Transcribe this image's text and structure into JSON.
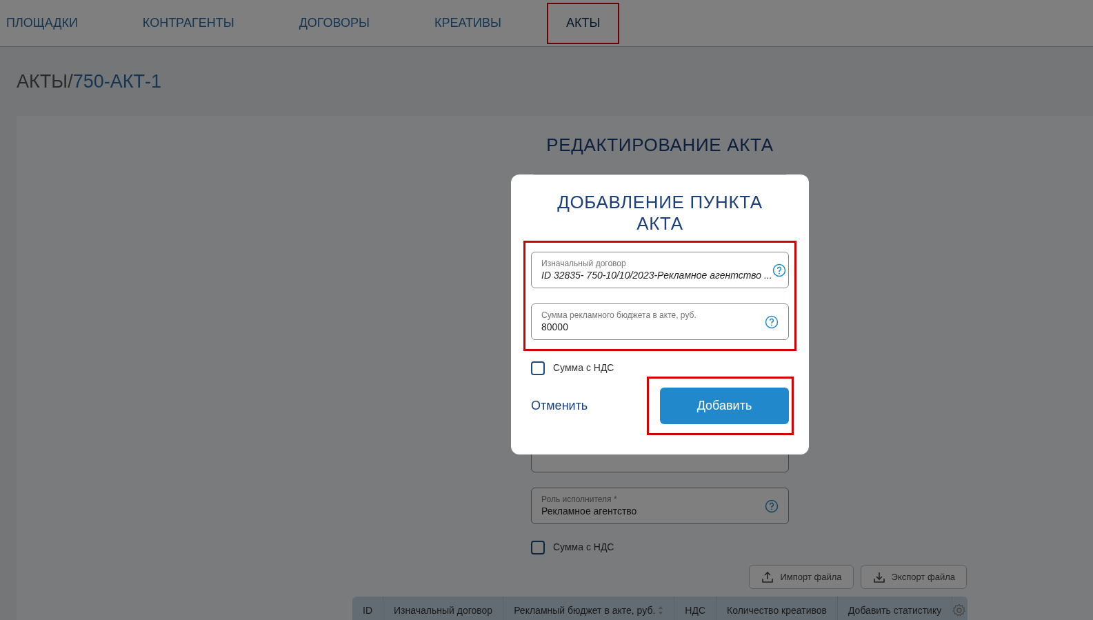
{
  "nav": {
    "tabs": [
      {
        "label": "ПЛОЩАДКИ",
        "selected": false,
        "highlighted": false
      },
      {
        "label": "КОНТРАГЕНТЫ",
        "selected": false,
        "highlighted": false
      },
      {
        "label": "ДОГОВОРЫ",
        "selected": false,
        "highlighted": false
      },
      {
        "label": "КРЕАТИВЫ",
        "selected": false,
        "highlighted": false
      },
      {
        "label": "АКТЫ",
        "selected": true,
        "highlighted": true
      }
    ]
  },
  "breadcrumb": {
    "section": "АКТЫ/",
    "current": "750-АКТ-1"
  },
  "form": {
    "title": "РЕДАКТИРОВАНИЕ АКТА",
    "fields": [
      {
        "label": "Роль исполнителя *",
        "value": "Рекламное агентство"
      }
    ],
    "checkbox": {
      "label": "Сумма с НДС",
      "checked": false
    }
  },
  "toolbar": [
    {
      "label": "Импорт файла",
      "kind": "upload"
    },
    {
      "label": "Экспорт файла",
      "kind": "download"
    }
  ],
  "table": {
    "columns": [
      {
        "label": "ID",
        "sortable": false
      },
      {
        "label": "Изначальный договор",
        "sortable": false
      },
      {
        "label": "Рекламный бюджет в акте, руб.",
        "sortable": true
      },
      {
        "label": "НДС",
        "sortable": false
      },
      {
        "label": "Количество креативов",
        "sortable": false
      },
      {
        "label": "Добавить статистику",
        "sortable": false
      }
    ]
  },
  "dialog": {
    "title": "ДОБАВЛЕНИЕ ПУНКТА АКТА",
    "fields_highlighted": true,
    "fields": [
      {
        "kind": "select",
        "label": "Изначальный договор",
        "value": "ID 32835- 750-10/10/2023-Рекламное агентство ..."
      },
      {
        "kind": "input",
        "label": "Сумма рекламного бюджета в акте, руб.",
        "value": "80000"
      }
    ],
    "checkbox": {
      "label": "Сумма с НДС",
      "checked": false
    },
    "cancel": "Отменить",
    "submit": {
      "label": "Добавить",
      "highlighted": true
    }
  }
}
